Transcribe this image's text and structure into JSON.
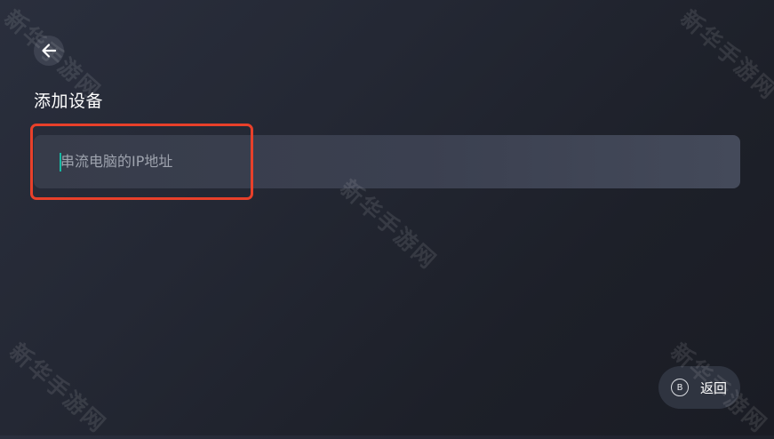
{
  "header": {
    "back_icon": "arrow-left-icon",
    "title": "添加设备"
  },
  "form": {
    "ip_input": {
      "placeholder": "串流电脑的IP地址",
      "value": ""
    },
    "highlight_color": "#e8402a",
    "caret_color": "#17b9a4"
  },
  "footer": {
    "return_button": {
      "key_hint": "B",
      "label": "返回"
    }
  },
  "watermarks": [
    "新华手游网",
    "新华手游网",
    "新华手游网",
    "新华手游网",
    "新华手游网"
  ]
}
